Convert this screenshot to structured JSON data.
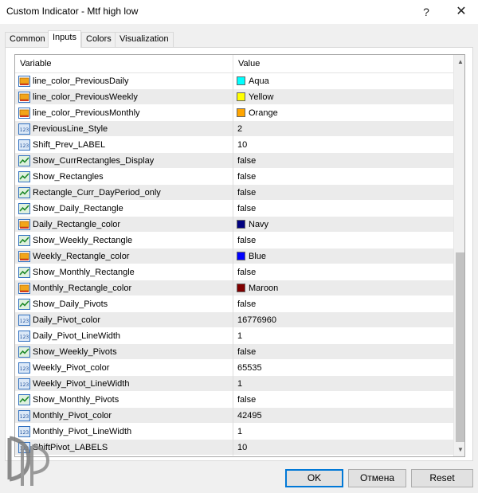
{
  "window": {
    "title": "Custom Indicator - Mtf high low",
    "help": "?",
    "close": "✕"
  },
  "tabs": [
    {
      "label": "Common",
      "active": false
    },
    {
      "label": "Inputs",
      "active": true
    },
    {
      "label": "Colors",
      "active": false
    },
    {
      "label": "Visualization",
      "active": false
    }
  ],
  "grid": {
    "header": {
      "variable": "Variable",
      "value": "Value"
    },
    "rows": [
      {
        "icon": "color-icon",
        "variable": "line_color_PreviousDaily",
        "value": "Aqua",
        "swatch": "#00ffff"
      },
      {
        "icon": "color-icon",
        "variable": "line_color_PreviousWeekly",
        "value": "Yellow",
        "swatch": "#ffff00"
      },
      {
        "icon": "color-icon",
        "variable": "line_color_PreviousMonthly",
        "value": "Orange",
        "swatch": "#ffa500"
      },
      {
        "icon": "integer-icon",
        "variable": "PreviousLine_Style",
        "value": "2"
      },
      {
        "icon": "integer-icon",
        "variable": "Shift_Prev_LABEL",
        "value": "10"
      },
      {
        "icon": "boolean-icon",
        "variable": "Show_CurrRectangles_Display",
        "value": "false"
      },
      {
        "icon": "boolean-icon",
        "variable": "Show_Rectangles",
        "value": "false"
      },
      {
        "icon": "boolean-icon",
        "variable": "Rectangle_Curr_DayPeriod_only",
        "value": "false"
      },
      {
        "icon": "boolean-icon",
        "variable": "Show_Daily_Rectangle",
        "value": "false"
      },
      {
        "icon": "color-icon",
        "variable": "Daily_Rectangle_color",
        "value": "Navy",
        "swatch": "#000080"
      },
      {
        "icon": "boolean-icon",
        "variable": "Show_Weekly_Rectangle",
        "value": "false"
      },
      {
        "icon": "color-icon",
        "variable": "Weekly_Rectangle_color",
        "value": "Blue",
        "swatch": "#0000ff"
      },
      {
        "icon": "boolean-icon",
        "variable": "Show_Monthly_Rectangle",
        "value": "false"
      },
      {
        "icon": "color-icon",
        "variable": "Monthly_Rectangle_color",
        "value": "Maroon",
        "swatch": "#800000"
      },
      {
        "icon": "boolean-icon",
        "variable": "Show_Daily_Pivots",
        "value": "false"
      },
      {
        "icon": "integer-icon",
        "variable": "Daily_Pivot_color",
        "value": "16776960"
      },
      {
        "icon": "integer-icon",
        "variable": "Daily_Pivot_LineWidth",
        "value": "1"
      },
      {
        "icon": "boolean-icon",
        "variable": "Show_Weekly_Pivots",
        "value": "false"
      },
      {
        "icon": "integer-icon",
        "variable": "Weekly_Pivot_color",
        "value": "65535"
      },
      {
        "icon": "integer-icon",
        "variable": "Weekly_Pivot_LineWidth",
        "value": "1"
      },
      {
        "icon": "boolean-icon",
        "variable": "Show_Monthly_Pivots",
        "value": "false"
      },
      {
        "icon": "integer-icon",
        "variable": "Monthly_Pivot_color",
        "value": "42495"
      },
      {
        "icon": "integer-icon",
        "variable": "Monthly_Pivot_LineWidth",
        "value": "1"
      },
      {
        "icon": "integer-icon",
        "variable": "ShiftPivot_LABELS",
        "value": "10"
      }
    ]
  },
  "scrollbar": {
    "up": "▲",
    "down": "▼"
  },
  "buttons": {
    "ok": "OK",
    "cancel": "Отмена",
    "reset": "Reset"
  },
  "colors": {
    "accent": "#0078d7",
    "row_alt": "#ebebeb",
    "dialog_bg": "#f0f0f0"
  }
}
